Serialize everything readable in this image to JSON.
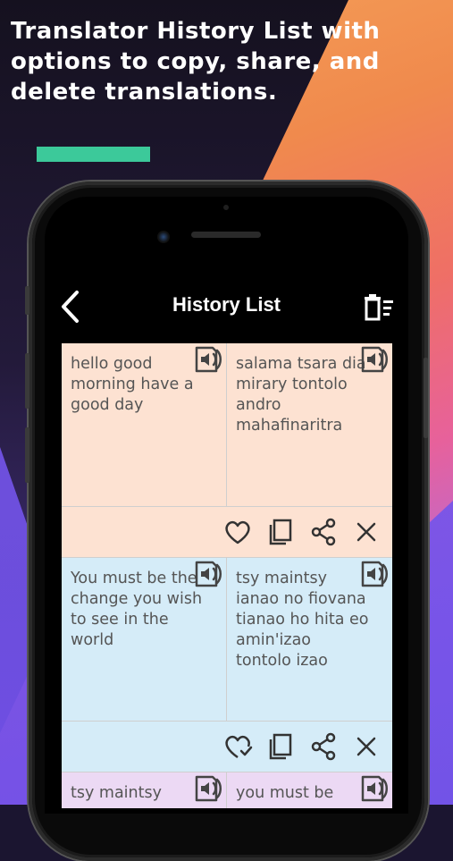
{
  "headline": "Translator History List with options to copy, share, and delete translations.",
  "app": {
    "title": "History List"
  },
  "colors": {
    "accent": "#3cc99a",
    "peach": "#fde2d2",
    "blue": "#d5ecf8",
    "lavender": "#ecd9f4"
  },
  "history": [
    {
      "source": "hello good morning have a good day",
      "target": "salama tsara dia mirary tontolo andro mahafinaritra",
      "color": "#fde2d2",
      "favorite": false
    },
    {
      "source": "You must be the change you wish to see in the world",
      "target": "tsy maintsy ianao no fiovana tianao ho hita eo amin'izao tontolo izao",
      "color": "#d5ecf8",
      "favorite": true
    },
    {
      "source": "tsy maintsy",
      "target": "you must be",
      "color": "#ecd9f4",
      "favorite": false
    }
  ]
}
